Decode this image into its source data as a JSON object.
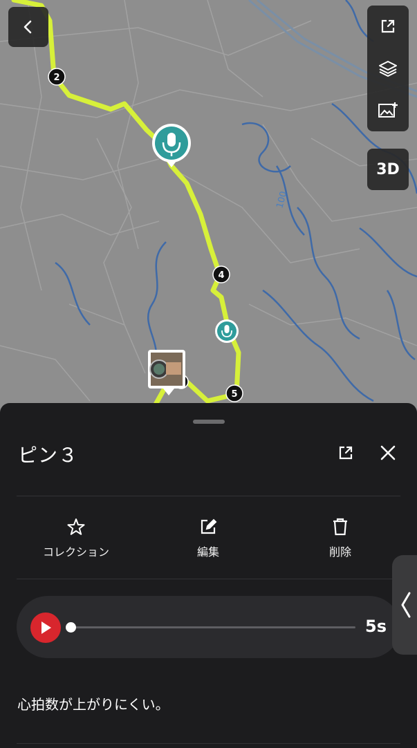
{
  "map": {
    "route_markers": [
      "2",
      "4",
      "5"
    ],
    "road_label": "100",
    "pin_icons": [
      "microphone-pin-icon",
      "microphone-pin-icon",
      "photo-pin-thumbnail"
    ],
    "colors": {
      "route": "#d7f03a",
      "water": "#3f6aa8",
      "background": "#8e8e8e"
    }
  },
  "map_controls": {
    "back_icon": "chevron-left-icon",
    "share_icon": "share-icon",
    "layers_icon": "layers-icon",
    "add_photo_icon": "add-image-icon",
    "view_3d_label": "3D"
  },
  "sheet": {
    "title": "ピン３",
    "share_icon": "share-icon",
    "close_icon": "close-icon",
    "actions": [
      {
        "label": "コレクション",
        "icon": "star-icon"
      },
      {
        "label": "編集",
        "icon": "edit-icon"
      },
      {
        "label": "削除",
        "icon": "trash-icon"
      }
    ],
    "audio": {
      "duration": "5s",
      "progress": 0,
      "accent": "#d8262d"
    },
    "memo": "心拍数が上がりにくい。",
    "side_tab_icon": "chevron-left-icon"
  }
}
